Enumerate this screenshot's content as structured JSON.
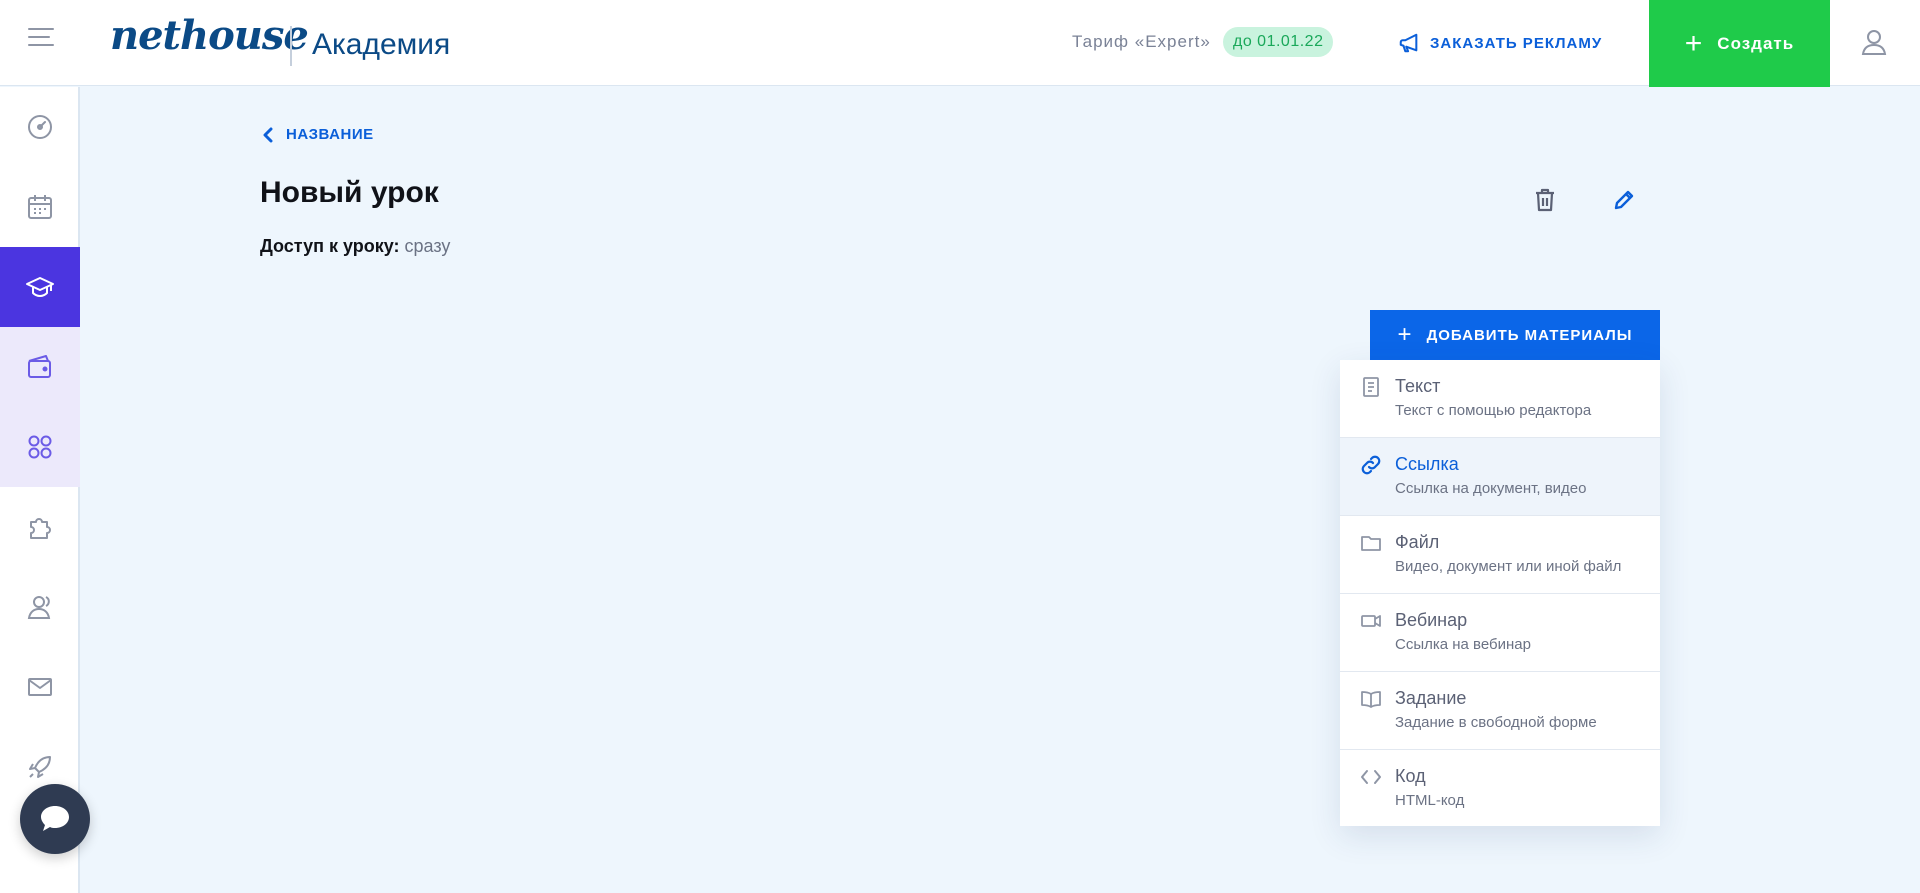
{
  "header": {
    "logo": "nethouse",
    "app_name": "Академия",
    "tariff_label": "Тариф «Expert»",
    "tariff_until": "до 01.01.22",
    "ad_label": "ЗАКАЗАТЬ РЕКЛАМУ",
    "create_label": "Создать"
  },
  "sidebar": {
    "icons": [
      "dashboard-icon",
      "calendar-icon",
      "academy-icon",
      "wallet-icon",
      "apps-icon",
      "puzzle-icon",
      "users-icon",
      "mail-icon",
      "rocket-icon"
    ]
  },
  "content": {
    "back_label": "НАЗВАНИЕ",
    "title": "Новый урок",
    "access_label": "Доступ к уроку:",
    "access_value": "сразу",
    "add_materials_label": "ДОБАВИТЬ МАТЕРИАЛЫ"
  },
  "menu": {
    "items": [
      {
        "title": "Текст",
        "subtitle": "Текст с помощью редактора",
        "icon": "document-icon"
      },
      {
        "title": "Ссылка",
        "subtitle": "Ссылка на документ, видео",
        "icon": "link-icon"
      },
      {
        "title": "Файл",
        "subtitle": "Видео, документ или иной файл",
        "icon": "folder-icon"
      },
      {
        "title": "Вебинар",
        "subtitle": "Ссылка на вебинар",
        "icon": "video-camera-icon"
      },
      {
        "title": "Задание",
        "subtitle": "Задание в свободной форме",
        "icon": "book-icon"
      },
      {
        "title": "Код",
        "subtitle": "HTML-код",
        "icon": "code-icon"
      }
    ]
  },
  "colors": {
    "accent": "#0b66e8",
    "create_green": "#1fcb4a",
    "sidebar_active": "#4b35e0"
  }
}
